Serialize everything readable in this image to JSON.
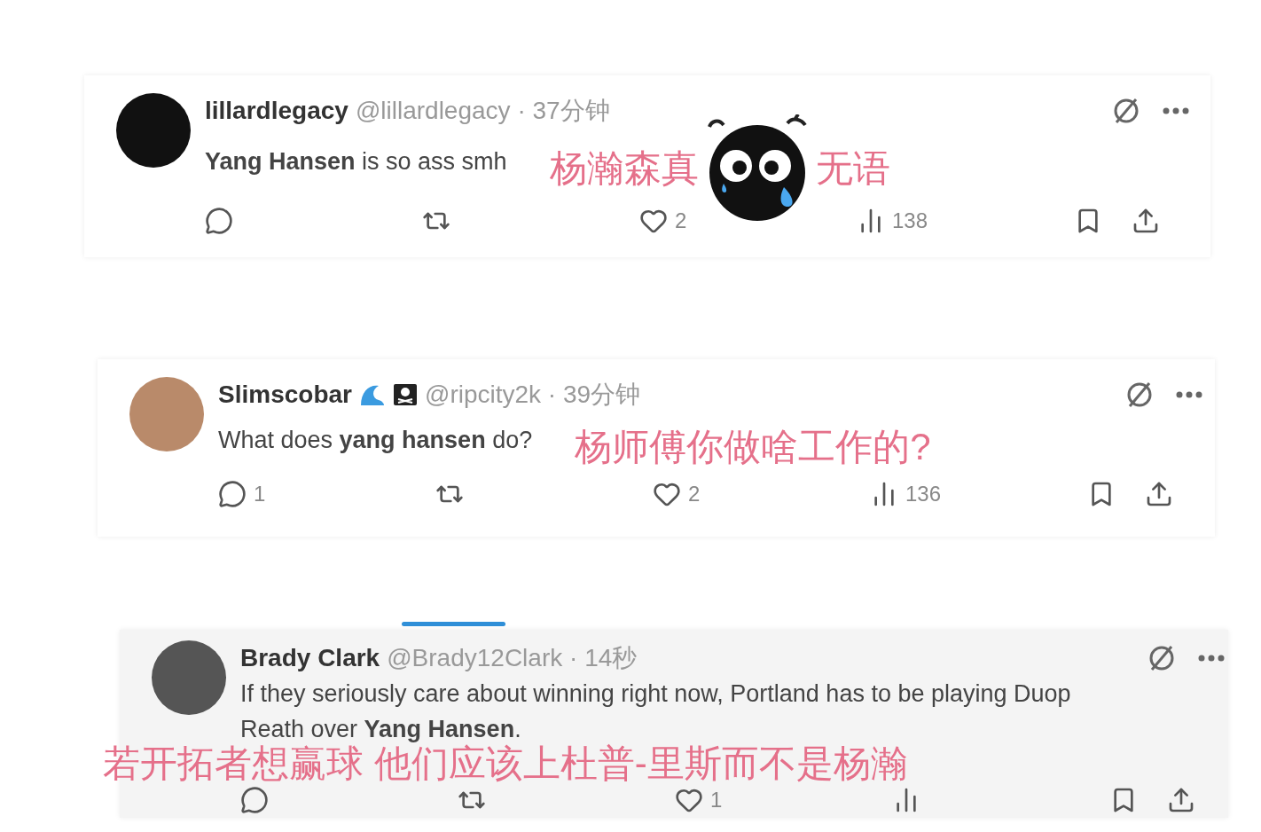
{
  "posts": [
    {
      "name": "lillardlegacy",
      "handle": "@lillardlegacy",
      "time": "· 37分钟",
      "text": "**Yang Hansen** is so ass smh",
      "annotation": [
        "杨瀚森真",
        "无语"
      ],
      "sticker": true,
      "actions": [
        {
          "kind": "reply"
        },
        {
          "kind": "retweet"
        },
        {
          "kind": "like",
          "count": "2"
        },
        {
          "kind": "views",
          "count": "138"
        },
        {
          "kind": "bookmark"
        },
        {
          "kind": "share"
        }
      ]
    },
    {
      "name": "Slimscobar",
      "badges": [
        {
          "kind": "wave"
        },
        {
          "kind": "pirate-flag"
        }
      ],
      "handle": "@ripcity2k",
      "time": "· 39分钟",
      "text": "What does **yang hansen** do?",
      "annotation": [
        "杨师傅你做啥工作的?"
      ],
      "actions": [
        {
          "kind": "reply",
          "count": "1"
        },
        {
          "kind": "retweet"
        },
        {
          "kind": "like",
          "count": "2"
        },
        {
          "kind": "views",
          "count": "136"
        },
        {
          "kind": "bookmark"
        },
        {
          "kind": "share"
        }
      ]
    },
    {
      "name": "Brady Clark",
      "handle": "@Brady12Clark",
      "time": "· 14秒",
      "text": "If they seriously care about winning right now, Portland has to be playing Duop Reath over **Yang Hansen**.",
      "annotation": [
        "若开拓者想赢球 他们应该上杜普-里斯而不是杨瀚"
      ],
      "tab_bar": true,
      "actions": [
        {
          "kind": "reply"
        },
        {
          "kind": "retweet"
        },
        {
          "kind": "like",
          "count": "1"
        },
        {
          "kind": "views"
        },
        {
          "kind": "bookmark"
        },
        {
          "kind": "share"
        }
      ]
    }
  ]
}
